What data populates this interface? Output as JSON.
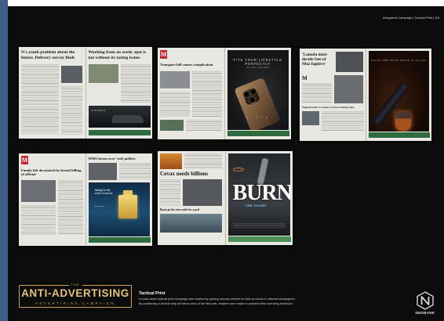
{
  "header": {
    "label": "Integrated Campaign | Tactical Print | 4/6"
  },
  "spreads": [
    {
      "headline_left": "N's youth problem about the future. Delivery survey finds",
      "headline_right": "Working from an exotic spot is not without its taxing issues",
      "ad_text": "A WORLD"
    },
    {
      "masthead_letter": "M",
      "headline": "Transport bill causes complication",
      "ad_tagline": "FITS YOUR LIFESTYLE PERFECTLY",
      "ad_sub": "Pro camera · all-day battery",
      "ad_brand": "V I N Y E"
    },
    {
      "headline": "'Lamola must decide fate of Moz fugitive'",
      "subhead": "Tragedy leads to review of school holiday trips",
      "masthead_letter": "M",
      "ad_tagline": "Savour THE RICH TASTE of success"
    },
    {
      "masthead_letter": "M",
      "headline_left": "Family left devastated by brutal killing of official",
      "headline_right": "WHO forms over 'seek politics'",
      "ad_tagline": "Indulge in the scent of success",
      "ad_sub": "Eau de parfum"
    },
    {
      "headline": "Covax needs billions",
      "headline_2": "Boats go the extra mile for a pod",
      "ad_burn": "BURN",
      "ad_burn_sub": "THE COURT"
    }
  ],
  "footer": {
    "logo_small": "THE",
    "logo_main": "ANTI-ADVERTISING",
    "logo_sub": "ADVERTISING CAMPAIGN",
    "title": "Tactical Print",
    "line1": "A mass-reach tactical print campaign was created by placing upscale adverts for fake products in national newspapers.",
    "line2": "By positioning a tactical strip ad below each of the fake ads, readers were made to question their spending behaviour.",
    "brand_name": "NEDBANK",
    "colors": {
      "gold": "#c9a45a",
      "board": "#0c0c0c",
      "sidebar": "#3e5f85",
      "brand_green": "#2e6b3f"
    }
  }
}
